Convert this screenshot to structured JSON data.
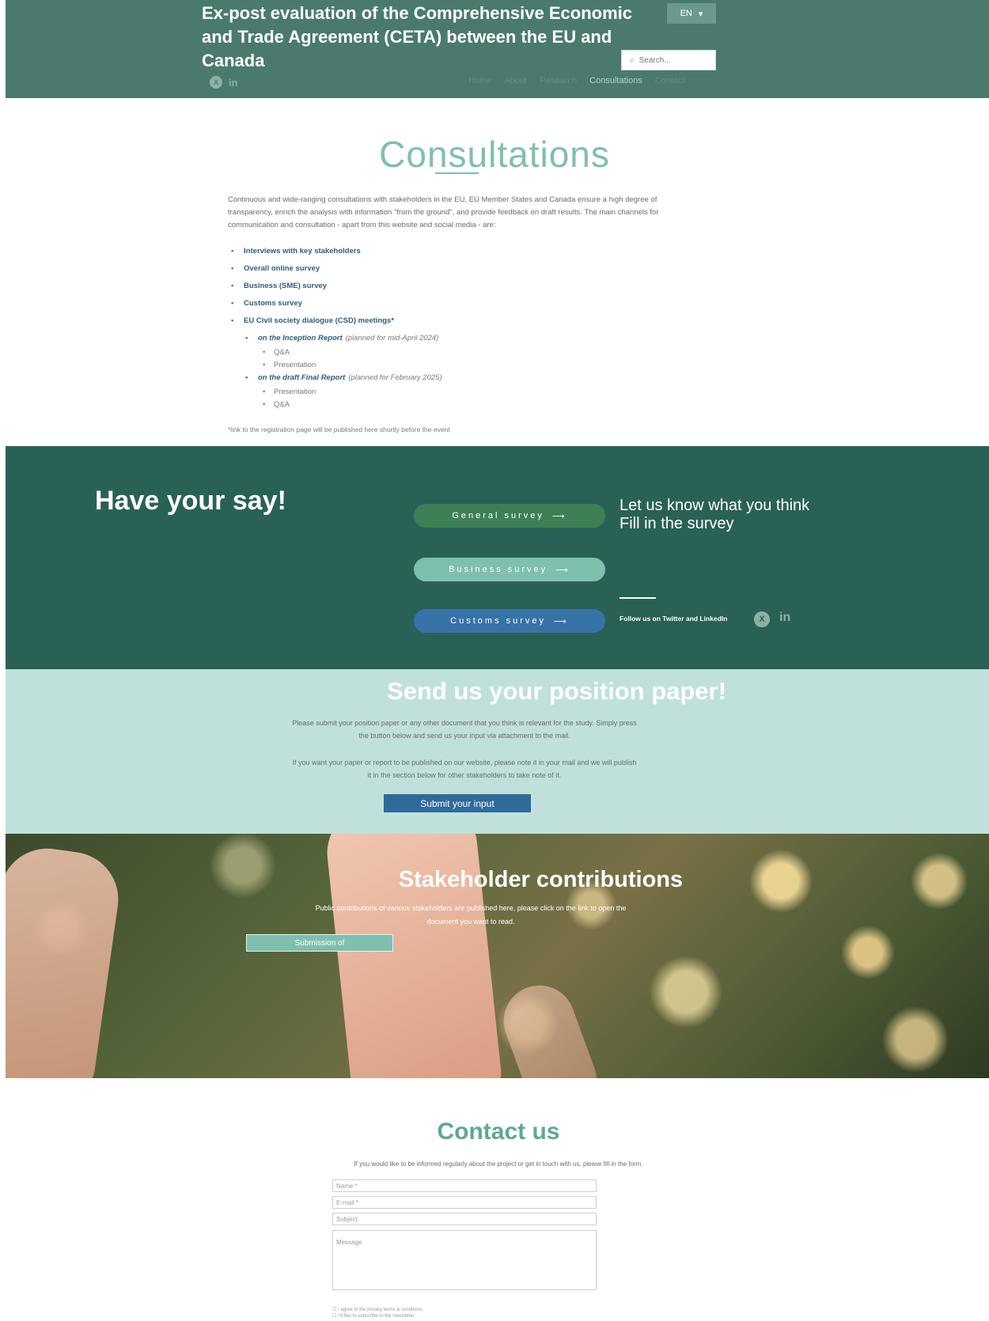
{
  "header": {
    "title_line1": "Ex-post evaluation of the Comprehensive Economic",
    "title_line2": "and Trade Agreement (CETA) between the EU and Canada",
    "language": "EN",
    "search_placeholder": "Search...",
    "nav": [
      "Home",
      "About",
      "Research",
      "Consultations",
      "Contact"
    ],
    "active_nav": "Consultations"
  },
  "consultations": {
    "title": "Consultations",
    "intro": "Continuous and wide-ranging consultations with stakeholders in the EU, EU Member States and Canada ensure a high degree of transparency, enrich the analysis with information \"from the ground\", and provide feedback on draft results. The main channels for communication and consultation - apart from this website and social media - are:",
    "items": [
      "Interviews with key stakeholders",
      "Overall online survey",
      "Business (SME) survey",
      "Customs survey",
      "EU Civil society dialogue (CSD) meetings*"
    ],
    "sub1": {
      "label": "on the Inception Report",
      "note": "(planned for mid-April 2024)",
      "children": [
        "Q&A",
        "Presentation"
      ]
    },
    "sub2": {
      "label": "on the draft Final Report",
      "note": "(planned for February 2025)",
      "children": [
        "Presentation",
        "Q&A"
      ]
    },
    "footnote": "*link to the registration page will be published here shortly before the event"
  },
  "have_your_say": {
    "title": "Have your say!",
    "general_survey": "General survey",
    "business_survey": "Business survey",
    "customs_survey": "Customs survey",
    "tagline1": "Let us know what you think",
    "tagline2": "Fill in the survey",
    "follow": "Follow us on Twitter and LinkedIn",
    "x_icon_label": "X",
    "in_icon_label": "in"
  },
  "position_paper": {
    "title": "Send us your position paper!",
    "text1": "Please submit your position paper or any other document that you think is relevant for the study. Simply press the button below and send us your input via attachment to the mail.",
    "text2": "If you want your paper or report to be published on our website, please note it in your mail and we will publish it in the section below for other stakeholders to take note of it.",
    "button": "Submit your input"
  },
  "stakeholder": {
    "title": "Stakeholder contributions",
    "text": "Public contributions of various stakeholders are published here, please click on the link to open the document you want to read.",
    "button": "Submission of"
  },
  "contact": {
    "title": "Contact us",
    "text": "If you would like to be informed regularly about the project or get in touch with us, please fill in the form.",
    "fields": [
      "Name *",
      "E-mail *",
      "Subject",
      "Message"
    ],
    "check1": "I agree to the privacy terms & conditions",
    "check2": "I'd like to subscribe to the newsletter"
  },
  "colors": {
    "header_bg": "#4a7a6e",
    "say_bg": "#2a6157",
    "paper_bg": "#c0e1db",
    "accent": "#7fbfae",
    "link": "#2f5e7a"
  }
}
